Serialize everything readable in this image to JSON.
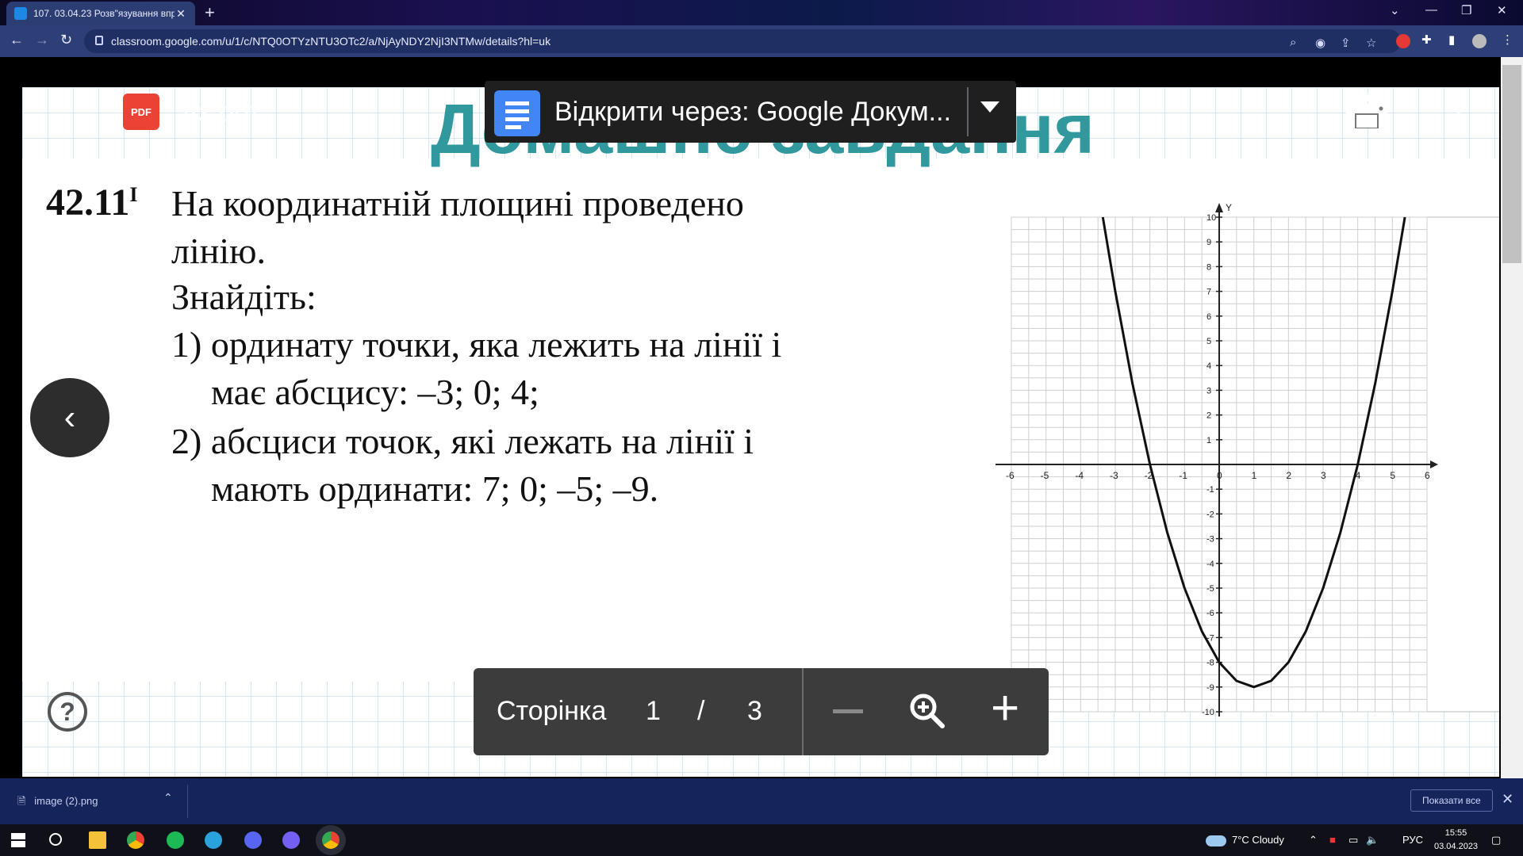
{
  "browser": {
    "tab_title": "107. 03.04.23 Розв\"язування впр",
    "url": "classroom.google.com/u/1/c/NTQ0OTYzNTU3OTc2/a/NjAyNDY2NjI3NTMw/details?hl=uk"
  },
  "viewer": {
    "file_name": "дз.pdf",
    "open_with": "Відкрити через: Google Докум...",
    "pdf_badge": "PDF",
    "page_label": "Сторінка",
    "page_current": "1",
    "page_sep": "/",
    "page_total": "3"
  },
  "document": {
    "watermark": "Домашнє завдання",
    "problem_number": "42.11",
    "problem_sup": "I",
    "line1": "На   координатній   площині   проведено",
    "line2": "лінію.",
    "line3": "Знайдіть:",
    "line4": "1) ординату точки, яка лежить на лінії і",
    "line5": "має абсцису: –3; 0; 4;",
    "line6": "2) абсциси точок, які лежать на лінії і",
    "line7": "мають ординати: 7; 0; –5; –9."
  },
  "chart_data": {
    "type": "line",
    "xlabel": "",
    "ylabel": "Y",
    "xlim": [
      -6,
      6
    ],
    "ylim": [
      -10,
      10
    ],
    "x_ticks": [
      -6,
      -5,
      -4,
      -3,
      -2,
      -1,
      0,
      1,
      2,
      3,
      4,
      5,
      6
    ],
    "y_ticks": [
      -10,
      -9,
      -8,
      -7,
      -6,
      -5,
      -4,
      -3,
      -2,
      -1,
      1,
      2,
      3,
      4,
      5,
      6,
      7,
      8,
      9,
      10
    ],
    "grid": true,
    "series": [
      {
        "x": [
          -3.36,
          -3,
          -2.5,
          -2,
          -1.5,
          -1,
          -0.5,
          0,
          0.5,
          1,
          1.5,
          2,
          2.5,
          3,
          3.5,
          4,
          4.5,
          5,
          5.36
        ],
        "y": [
          10,
          7,
          3.25,
          0,
          -2.75,
          -5,
          -6.75,
          -8,
          -8.75,
          -9,
          -8.75,
          -8,
          -6.75,
          -5,
          -2.75,
          0,
          3.25,
          7,
          10
        ]
      }
    ]
  },
  "downloads": {
    "file": "image (2).png",
    "show_all": "Показати все"
  },
  "taskbar": {
    "weather": "7°C  Cloudy",
    "lang": "РУС",
    "time": "15:55",
    "date": "03.04.2023"
  }
}
